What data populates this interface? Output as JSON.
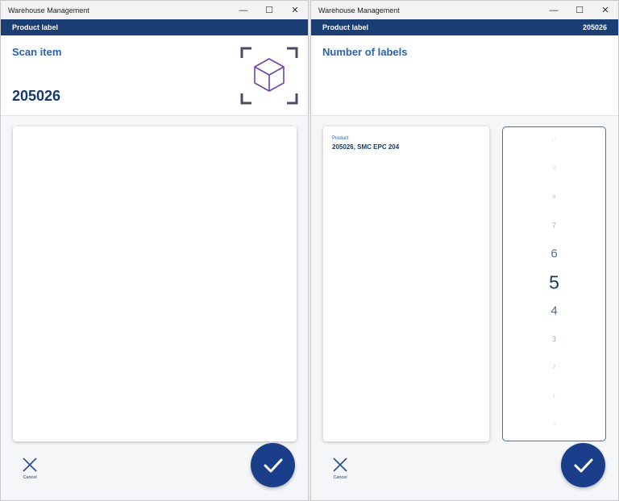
{
  "left_window": {
    "title": "Warehouse Management",
    "appbar": {
      "title": "Product label",
      "right": ""
    },
    "header": {
      "title": "Scan item",
      "value": "205026",
      "icon": "scan-cube-icon"
    },
    "footer": {
      "cancel_label": "Cancel",
      "confirm_icon": "check-icon"
    }
  },
  "right_window": {
    "title": "Warehouse Management",
    "appbar": {
      "title": "Product label",
      "right": "205026"
    },
    "header": {
      "title": "Number of labels"
    },
    "product": {
      "label": "Product",
      "value": "205026, SMC EPC 204"
    },
    "picker": {
      "options": [
        "10",
        "9",
        "8",
        "7",
        "6",
        "5",
        "4",
        "3",
        "2",
        "1",
        "0"
      ],
      "selected": "5"
    },
    "footer": {
      "cancel_label": "Cancel",
      "confirm_icon": "check-icon"
    }
  },
  "window_controls": {
    "minimize": "—",
    "maximize": "☐",
    "close": "✕"
  },
  "colors": {
    "appbar": "#1b3e75",
    "accent": "#2b62a8",
    "confirm": "#1b3e8a"
  }
}
